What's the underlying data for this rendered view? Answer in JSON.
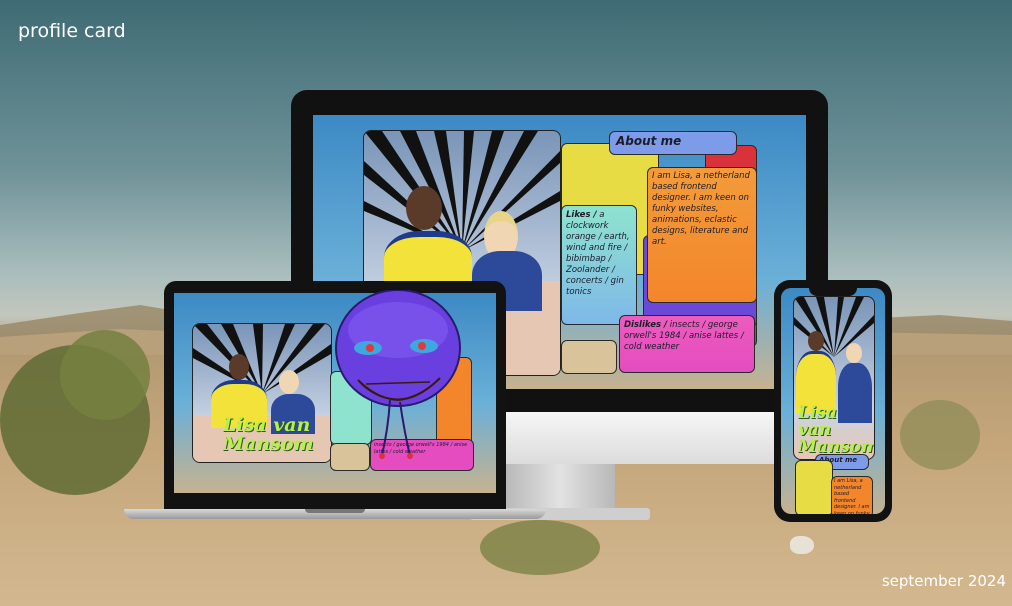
{
  "captions": {
    "title": "profile card",
    "date": "september 2024"
  },
  "card": {
    "name": "Lisa van Mansom",
    "about_heading": "About me",
    "about_text": "I am Lisa, a netherland based frontend designer. I am keen on funky websites, animations, eclastic designs, literature and art.",
    "likes_heading": "Likes /",
    "likes_text": "a clockwork orange / earth, wind and fire / bibimbap / Zoolander / concerts / gin tonics",
    "dislikes_heading": "Dislikes /",
    "dislikes_text": "insects / george orwell's 1984 / anise lattes / cold weather"
  },
  "colors": {
    "accent_green": "#b7f04a",
    "yellow": "#e8dc45",
    "orange": "#f3862a",
    "pink": "#e44cc0",
    "teal": "#8ee3cf",
    "blue": "#7d9be8",
    "red": "#d9323a",
    "purple_mask": "#6a3fe0"
  },
  "icons": [
    "mask-illustration",
    "device-monitor",
    "device-laptop",
    "device-phone"
  ]
}
